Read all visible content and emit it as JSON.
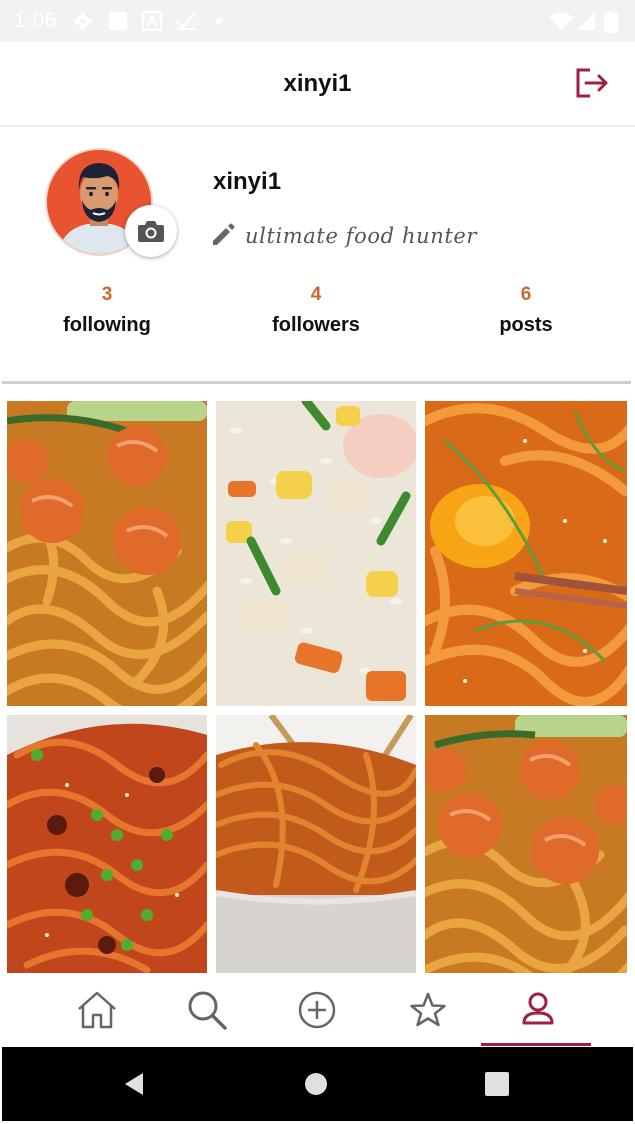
{
  "status_bar": {
    "time": "1:06",
    "icons": [
      "settings-icon",
      "square-icon",
      "a-icon",
      "check-icon",
      "dot-icon",
      "wifi-icon",
      "signal-icon",
      "battery-icon"
    ]
  },
  "header": {
    "title": "xinyi1",
    "logout_icon": "logout-icon",
    "accent_color": "#a02040"
  },
  "profile": {
    "username": "xinyi1",
    "bio": "ultimate food hunter",
    "edit_icon": "pencil-icon",
    "camera_icon": "camera-icon",
    "stats": [
      {
        "count": "3",
        "label": "following"
      },
      {
        "count": "4",
        "label": "followers"
      },
      {
        "count": "6",
        "label": "posts"
      }
    ],
    "count_color": "#c8692d"
  },
  "posts": [
    {
      "dish": "shrimp-udon"
    },
    {
      "dish": "fried-rice"
    },
    {
      "dish": "udon-with-egg"
    },
    {
      "dish": "spicy-noodles"
    },
    {
      "dish": "noodle-bowl"
    },
    {
      "dish": "shrimp-udon"
    }
  ],
  "bottom_nav": {
    "items": [
      "home-icon",
      "search-icon",
      "add-icon",
      "star-icon",
      "profile-icon"
    ],
    "active": "profile-icon"
  },
  "system_nav": [
    "back-icon",
    "home-circle-icon",
    "recents-icon"
  ]
}
